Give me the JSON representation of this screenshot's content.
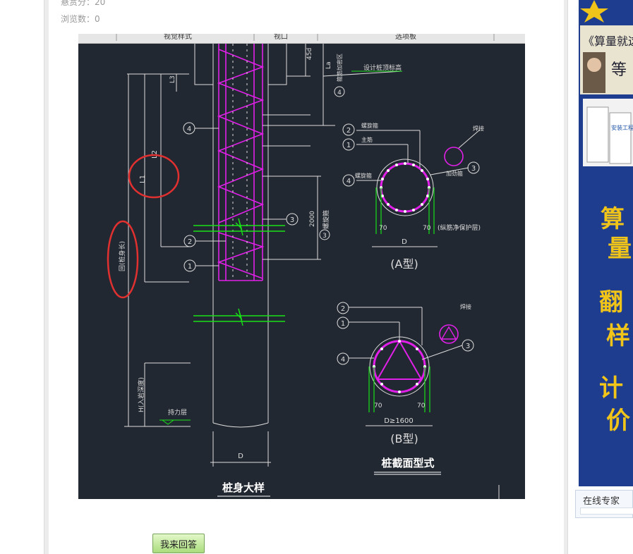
{
  "question_meta": {
    "reward_label": "悬赏分：",
    "reward_value": "20",
    "views_label": "浏览数：",
    "views_value": "0"
  },
  "screenshot": {
    "toolbar_items": [
      "视觉样式",
      "视口",
      "选项板"
    ],
    "drawing": {
      "left_title": "桩身大样",
      "right_title": "桩截面型式",
      "type_a": "(A型)",
      "type_b": "(B型)",
      "labels": {
        "d": "D",
        "d_b": "D≥1600",
        "dim_70": "70",
        "dim_2000": "2000",
        "dim_45d": "45d",
        "la": "La",
        "l1": "L1",
        "l2": "L2",
        "h_label": "H(入岩深度)",
        "l3_label": "回(桩身长)",
        "pile_top": "设计桩顶标高",
        "bearing": "持力层",
        "spiral_label": "螺旋箍",
        "main_rebar": "主筋",
        "stiffener": "加劲箍",
        "weld": "焊接",
        "protect": "(纵筋净保护层)",
        "spiral_vertical": "螺旋箍"
      },
      "circles": [
        "1",
        "2",
        "3",
        "4"
      ]
    }
  },
  "answer_button": "我来回答",
  "ad": {
    "book_title": "《算量就这么",
    "subtitle": "等",
    "vertical_text": [
      "算",
      "量",
      "翻",
      "样",
      "计",
      "价"
    ],
    "book_tag": "安装工程"
  },
  "expert_panel": {
    "title": "在线专家"
  },
  "colors": {
    "cad_bg": "#222831",
    "magenta": "#e020e8",
    "green": "#19e019",
    "ad_blue": "#1e3d8f",
    "ad_text": "#f0c419",
    "highlight_red": "#e03030"
  }
}
